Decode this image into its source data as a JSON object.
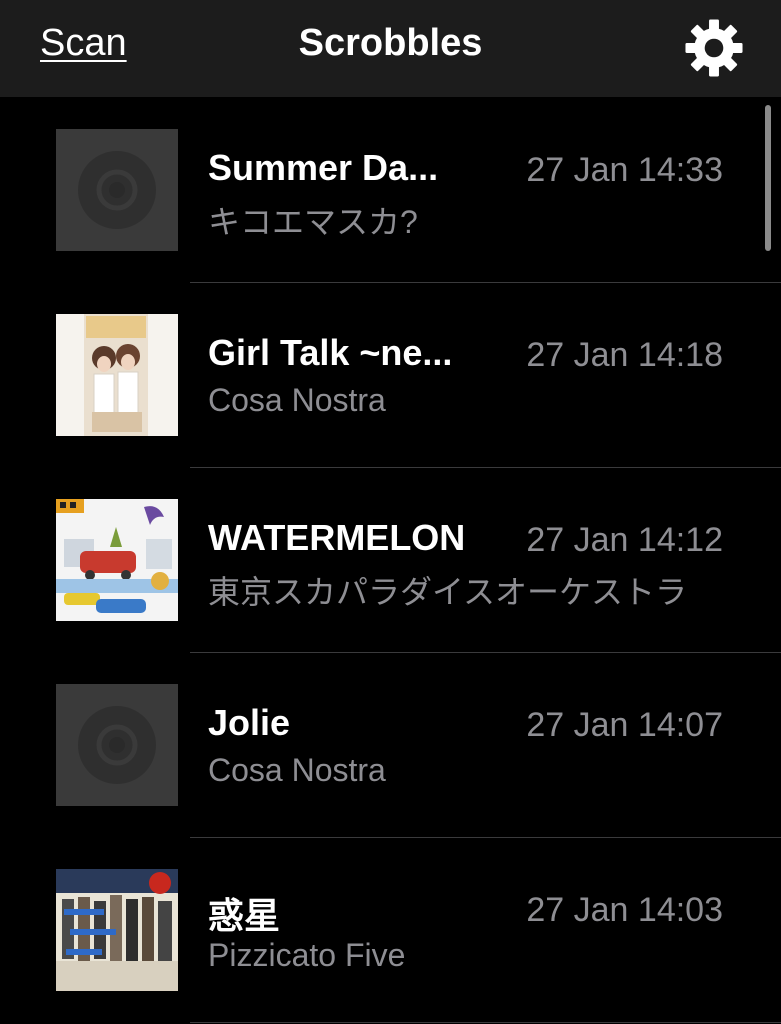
{
  "nav": {
    "scan_label": "Scan",
    "title": "Scrobbles",
    "settings_icon": "gear-icon"
  },
  "tracks": [
    {
      "name": "Summer Da...",
      "artist": "キコエマスカ?",
      "time": "27 Jan 14:33",
      "art": "placeholder-disc"
    },
    {
      "name": "Girl Talk ~ne...",
      "artist": "Cosa Nostra",
      "time": "27 Jan 14:18",
      "art": "album-cover"
    },
    {
      "name": "WATERMELON",
      "artist": "東京スカパラダイスオーケストラ",
      "time": "27 Jan 14:12",
      "art": "album-cover"
    },
    {
      "name": "Jolie",
      "artist": "Cosa Nostra",
      "time": "27 Jan 14:07",
      "art": "placeholder-disc"
    },
    {
      "name": "惑星",
      "artist": "Pizzicato Five",
      "time": "27 Jan 14:03",
      "art": "album-cover"
    }
  ],
  "colors": {
    "background": "#000000",
    "nav_background": "#1c1c1c",
    "secondary_text": "#8e8e93",
    "separator": "#3a3a3c"
  }
}
